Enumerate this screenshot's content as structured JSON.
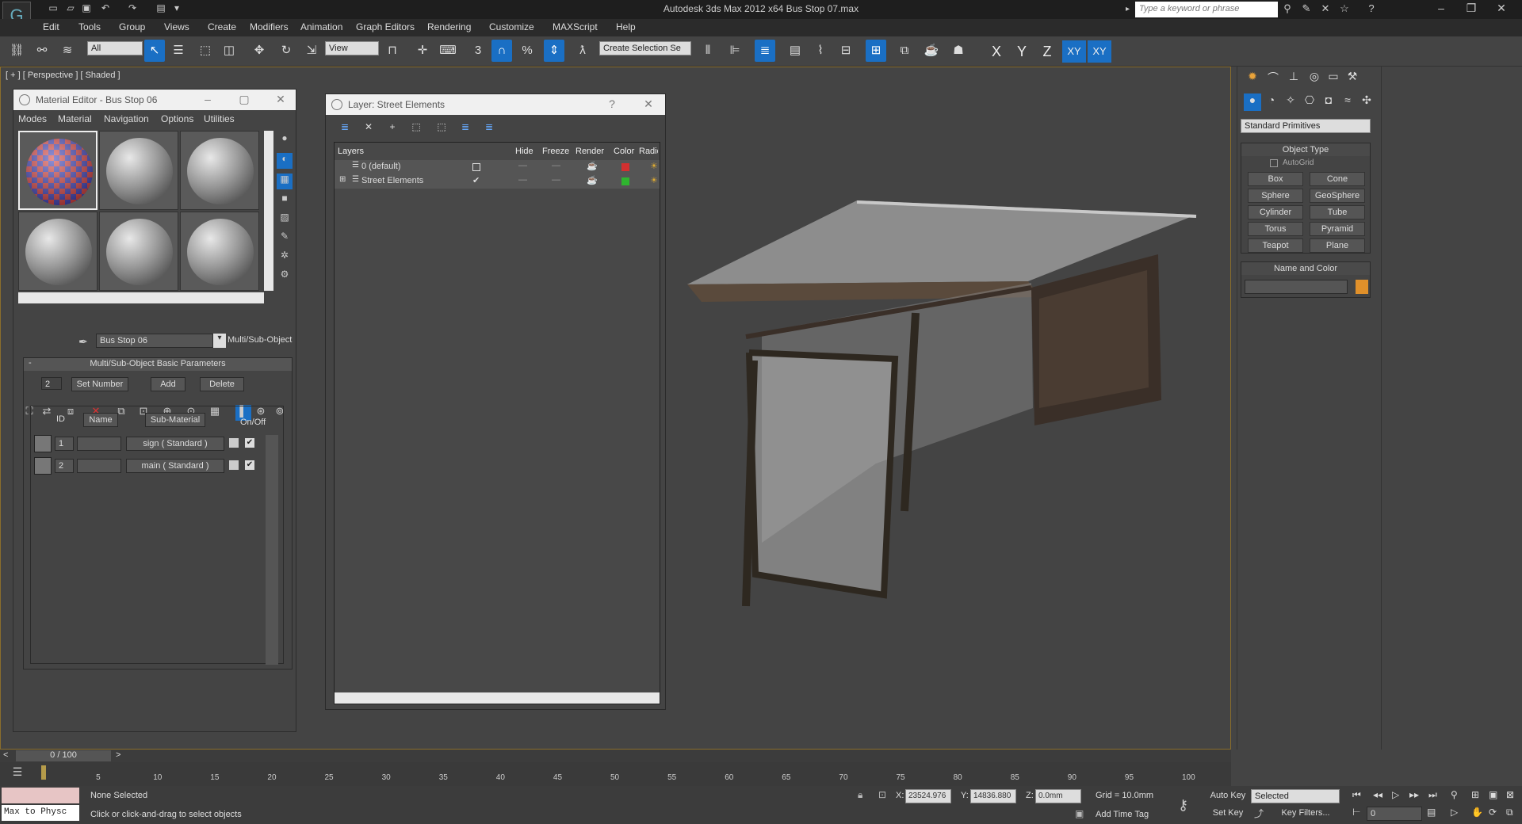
{
  "window": {
    "title": "Autodesk 3ds Max  2012 x64      Bus Stop 07.max",
    "search_placeholder": "Type a keyword or phrase"
  },
  "menubar": [
    "Edit",
    "Tools",
    "Group",
    "Views",
    "Create",
    "Modifiers",
    "Animation",
    "Graph Editors",
    "Rendering",
    "Customize",
    "MAXScript",
    "Help"
  ],
  "toolbar": {
    "selection_filter": "All",
    "ref_coord": "View",
    "snap_angle": "3",
    "named_selection_placeholder": "Create Selection Se",
    "axes": [
      "X",
      "Y",
      "Z",
      "XY",
      "XY"
    ]
  },
  "viewport": {
    "label": "[ + ] [ Perspective ] [ Shaded ]"
  },
  "material_editor": {
    "title": "Material Editor - Bus Stop 06",
    "menus": [
      "Modes",
      "Material",
      "Navigation",
      "Options",
      "Utilities"
    ],
    "material_name": "Bus Stop 06",
    "material_type": "Multi/Sub-Object",
    "rollout_title": "Multi/Sub-Object Basic Parameters",
    "set_number_value": "2",
    "set_number_label": "Set Number",
    "add_label": "Add",
    "delete_label": "Delete",
    "columns": [
      "ID",
      "Name",
      "Sub-Material",
      "On/Off"
    ],
    "rows": [
      {
        "id": "1",
        "name": "",
        "sub_material": "sign  ( Standard )"
      },
      {
        "id": "2",
        "name": "",
        "sub_material": "main  ( Standard )"
      }
    ]
  },
  "layer_manager": {
    "title": "Layer: Street Elements",
    "columns": [
      "Layers",
      "Hide",
      "Freeze",
      "Render",
      "Color",
      "Radio"
    ],
    "rows": [
      {
        "name": "0 (default)",
        "color": "#d23030"
      },
      {
        "name": "Street Elements",
        "color": "#2fb52f"
      }
    ]
  },
  "command_panel": {
    "category": "Standard Primitives",
    "object_type_title": "Object Type",
    "autogrid": "AutoGrid",
    "buttons": [
      "Box",
      "Cone",
      "Sphere",
      "GeoSphere",
      "Cylinder",
      "Tube",
      "Torus",
      "Pyramid",
      "Teapot",
      "Plane"
    ],
    "name_color_title": "Name and Color",
    "object_color": "#e0902a"
  },
  "timeline": {
    "frame_readout": "0 / 100",
    "ticks": [
      "5",
      "10",
      "15",
      "20",
      "25",
      "30",
      "35",
      "40",
      "45",
      "50",
      "55",
      "60",
      "65",
      "70",
      "75",
      "80",
      "85",
      "90",
      "95",
      "100"
    ]
  },
  "status": {
    "maxscript": "Max to Physc",
    "selection": "None Selected",
    "prompt": "Click or click-and-drag to select objects",
    "x_label": "X:",
    "x_value": "23524.976",
    "y_label": "Y:",
    "y_value": "14836.880",
    "z_label": "Z:",
    "z_value": "0.0mm",
    "grid": "Grid = 10.0mm",
    "add_time_tag": "Add Time Tag",
    "auto_key": "Auto Key",
    "set_key": "Set Key",
    "key_mode": "Selected",
    "key_filters": "Key Filters...",
    "current_frame": "0"
  }
}
